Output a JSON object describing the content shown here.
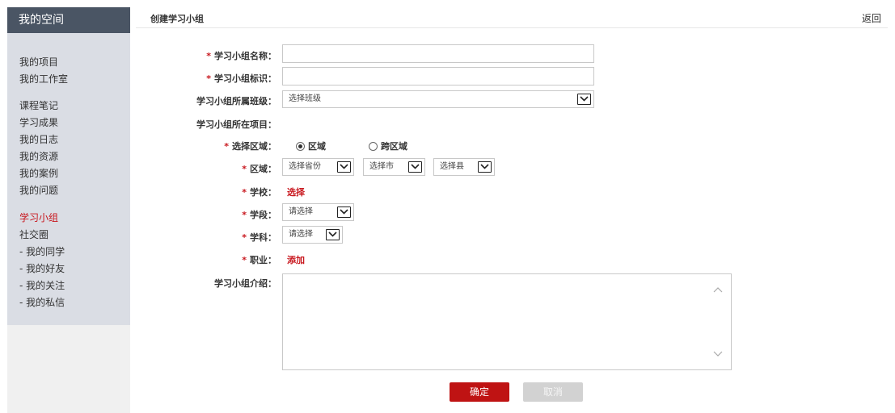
{
  "sidebar": {
    "title": "我的空间",
    "items": [
      {
        "label": "我的项目"
      },
      {
        "label": "我的工作室"
      },
      {
        "label": "课程笔记"
      },
      {
        "label": "学习成果"
      },
      {
        "label": "我的日志"
      },
      {
        "label": "我的资源"
      },
      {
        "label": "我的案例"
      },
      {
        "label": "我的问题"
      },
      {
        "label": "学习小组",
        "active": true
      },
      {
        "label": "社交圈"
      },
      {
        "label": "- 我的同学"
      },
      {
        "label": "- 我的好友"
      },
      {
        "label": "- 我的关注"
      },
      {
        "label": "- 我的私信"
      }
    ]
  },
  "header": {
    "title": "创建学习小组",
    "back_label": "返回"
  },
  "form": {
    "required_mark": "*",
    "group_name_label": "学习小组名称：",
    "group_name_value": "",
    "group_id_label": "学习小组标识：",
    "group_id_value": "",
    "class_label": "学习小组所属班级：",
    "class_selected": "选择班级",
    "project_label": "学习小组所在项目：",
    "region_type_label": "选择区域：",
    "region_option_local": "区域",
    "region_option_cross": "跨区域",
    "region_label": "区域：",
    "province_selected": "选择省份",
    "city_selected": "选择市",
    "county_selected": "选择县",
    "school_label": "学校：",
    "school_action": "选择",
    "stage_label": "学段：",
    "stage_selected": "请选择",
    "subject_label": "学科：",
    "subject_selected": "请选择",
    "career_label": "职业：",
    "career_action": "添加",
    "intro_label": "学习小组介绍：",
    "intro_value": ""
  },
  "buttons": {
    "confirm": "确定",
    "cancel": "取消"
  },
  "colors": {
    "sidebar_header": "#4a5564",
    "sidebar_menu": "#dadde4",
    "accent_red": "#c8161d",
    "confirm_button": "#bf1313",
    "cancel_button": "#d2d2d2"
  }
}
